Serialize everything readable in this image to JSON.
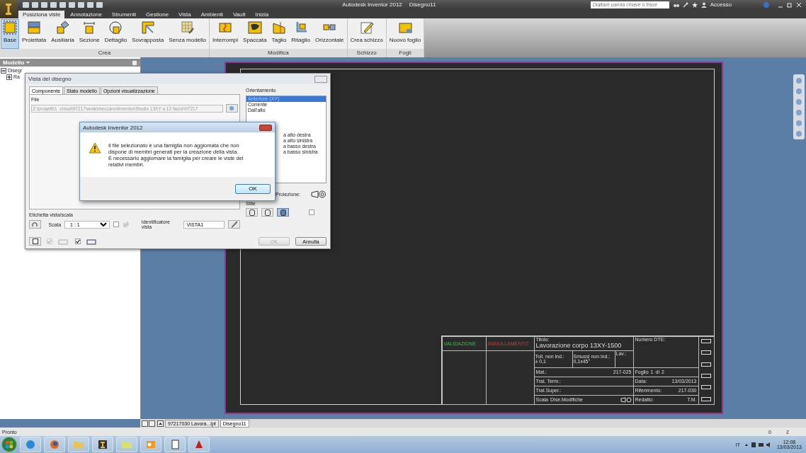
{
  "window": {
    "title": "Autodesk Inventor 2012",
    "document": "Disegno11",
    "search": {
      "placeholder": "Digitare parola chiave o frase"
    },
    "account": "Accesso"
  },
  "ribbon_tabs": [
    {
      "label": "Posiziona viste",
      "selected": true
    },
    {
      "label": "Annotazione",
      "selected": false
    },
    {
      "label": "Strumenti",
      "selected": false
    },
    {
      "label": "Gestione",
      "selected": false
    },
    {
      "label": "Vista",
      "selected": false
    },
    {
      "label": "Ambienti",
      "selected": false
    },
    {
      "label": "Vault",
      "selected": false
    },
    {
      "label": "Inizia",
      "selected": false
    }
  ],
  "ribbon_panels": [
    {
      "label": "Crea",
      "buttons": [
        {
          "label": "Base",
          "selected": true
        },
        {
          "label": "Proiettata",
          "selected": false
        },
        {
          "label": "Ausiliaria",
          "selected": false
        },
        {
          "label": "Sezione",
          "selected": false
        },
        {
          "label": "Dettaglio",
          "selected": false
        },
        {
          "label": "Sovrapposta",
          "selected": false
        },
        {
          "label": "Senza modello",
          "selected": false
        }
      ]
    },
    {
      "label": "Modifica",
      "buttons": [
        {
          "label": "Interrompi",
          "selected": false
        },
        {
          "label": "Spaccata",
          "selected": false
        },
        {
          "label": "Taglio",
          "selected": false
        },
        {
          "label": "Ritaglio",
          "selected": false
        },
        {
          "label": "Orizzontale",
          "selected": false
        }
      ]
    },
    {
      "label": "Schizzo",
      "buttons": [
        {
          "label": "Crea schizzo",
          "selected": false
        }
      ]
    },
    {
      "label": "Fogli",
      "buttons": [
        {
          "label": "Nuovo foglio",
          "selected": false
        }
      ]
    }
  ],
  "browser": {
    "title": "Modello",
    "tree": [
      {
        "label": "Disegr",
        "expanded": true,
        "children": [
          {
            "label": "Ra",
            "expanded": false
          }
        ]
      }
    ]
  },
  "dialog": {
    "title": "Vista del disegno",
    "tabs": [
      {
        "label": "Componente",
        "selected": true
      },
      {
        "label": "Stato modello",
        "selected": false
      },
      {
        "label": "Opzioni visualizzazione",
        "selected": false
      }
    ],
    "file_label": "File",
    "file_value": "Z:\\progetti\\1_chiusi\\97217\\work\\meccano\\Inventor\\Studio 13XY a 12 facce\\97217",
    "orientation": {
      "label": "Orientamento",
      "items": [
        {
          "label": "Anteriore (XY)",
          "selected": true
        },
        {
          "label": "Corrente",
          "selected": false
        },
        {
          "label": "Dall'alto",
          "selected": false
        }
      ],
      "partial_items": [
        "a alto destra",
        "a alto sinistra",
        "a basso destra",
        "a basso sinistra"
      ]
    },
    "projection_label": "Proiezione:",
    "label_section": "Etichetta vista/scala",
    "scale_label": "Scala",
    "scale_value": "1 : 1",
    "scale_checkbox": {
      "checked": false
    },
    "style_checkbox": {
      "checked": false
    },
    "identifier_label": "Identificatore vista",
    "identifier_value": "VISTA1",
    "style_label": "Stile",
    "styles": [
      {
        "selected": false
      },
      {
        "selected": false
      },
      {
        "selected": true
      }
    ],
    "options": [
      {
        "checked": true,
        "disabled": true
      },
      {
        "checked": true,
        "disabled": false
      }
    ],
    "ok": {
      "label": "OK",
      "disabled": true
    },
    "cancel": {
      "label": "Annulla",
      "disabled": false
    }
  },
  "message_box": {
    "title": "Autodesk Inventor 2012",
    "lines": [
      "Il file selezionato è una famiglia non aggiomata che non dispone di membri generati per la creazione della vista.",
      "È necessario aggiomare la famiglia per creare le viste dei relativi membri."
    ],
    "button": "OK"
  },
  "title_block": {
    "validation": "VALIDAZIONE",
    "cancellation": "ANNULLAMENTO",
    "title_label": "Titolo:",
    "title": "Lavorazione corpo 13XY-1500",
    "dte_label": "Numero DTE:",
    "tolerance_label": "Toll. non ind.:",
    "tolerance": "± 0,1",
    "chamfer_label": "Smussi non ind.:",
    "chamfer": "0,1x45°",
    "work_label": "Lav.:",
    "sheet_label": "Foglio",
    "sheet": "1",
    "of": "di",
    "sheets": "2",
    "material_label": "Mat.:",
    "material": "217-025",
    "date_label": "Data:",
    "date": "13/03/2013",
    "heat_label": "Trat. Term.:",
    "reference_label": "Riferimento:",
    "reference": "217-030",
    "surface_label": "Trat.Super.:",
    "author_label": "Redatto:",
    "author": "T.M.",
    "scale_label": "Scala",
    "changes_label": "Dise.Modifiche"
  },
  "document_tabs": [
    {
      "label": "97217030 Lavora...ipt",
      "selected": false
    },
    {
      "label": "Disegno11",
      "selected": true
    }
  ],
  "status_bar": {
    "text": "Pronto",
    "values": [
      "0",
      "2"
    ]
  },
  "taskbar": {
    "language": "IT",
    "time": "12:08",
    "date": "13/03/2013"
  }
}
